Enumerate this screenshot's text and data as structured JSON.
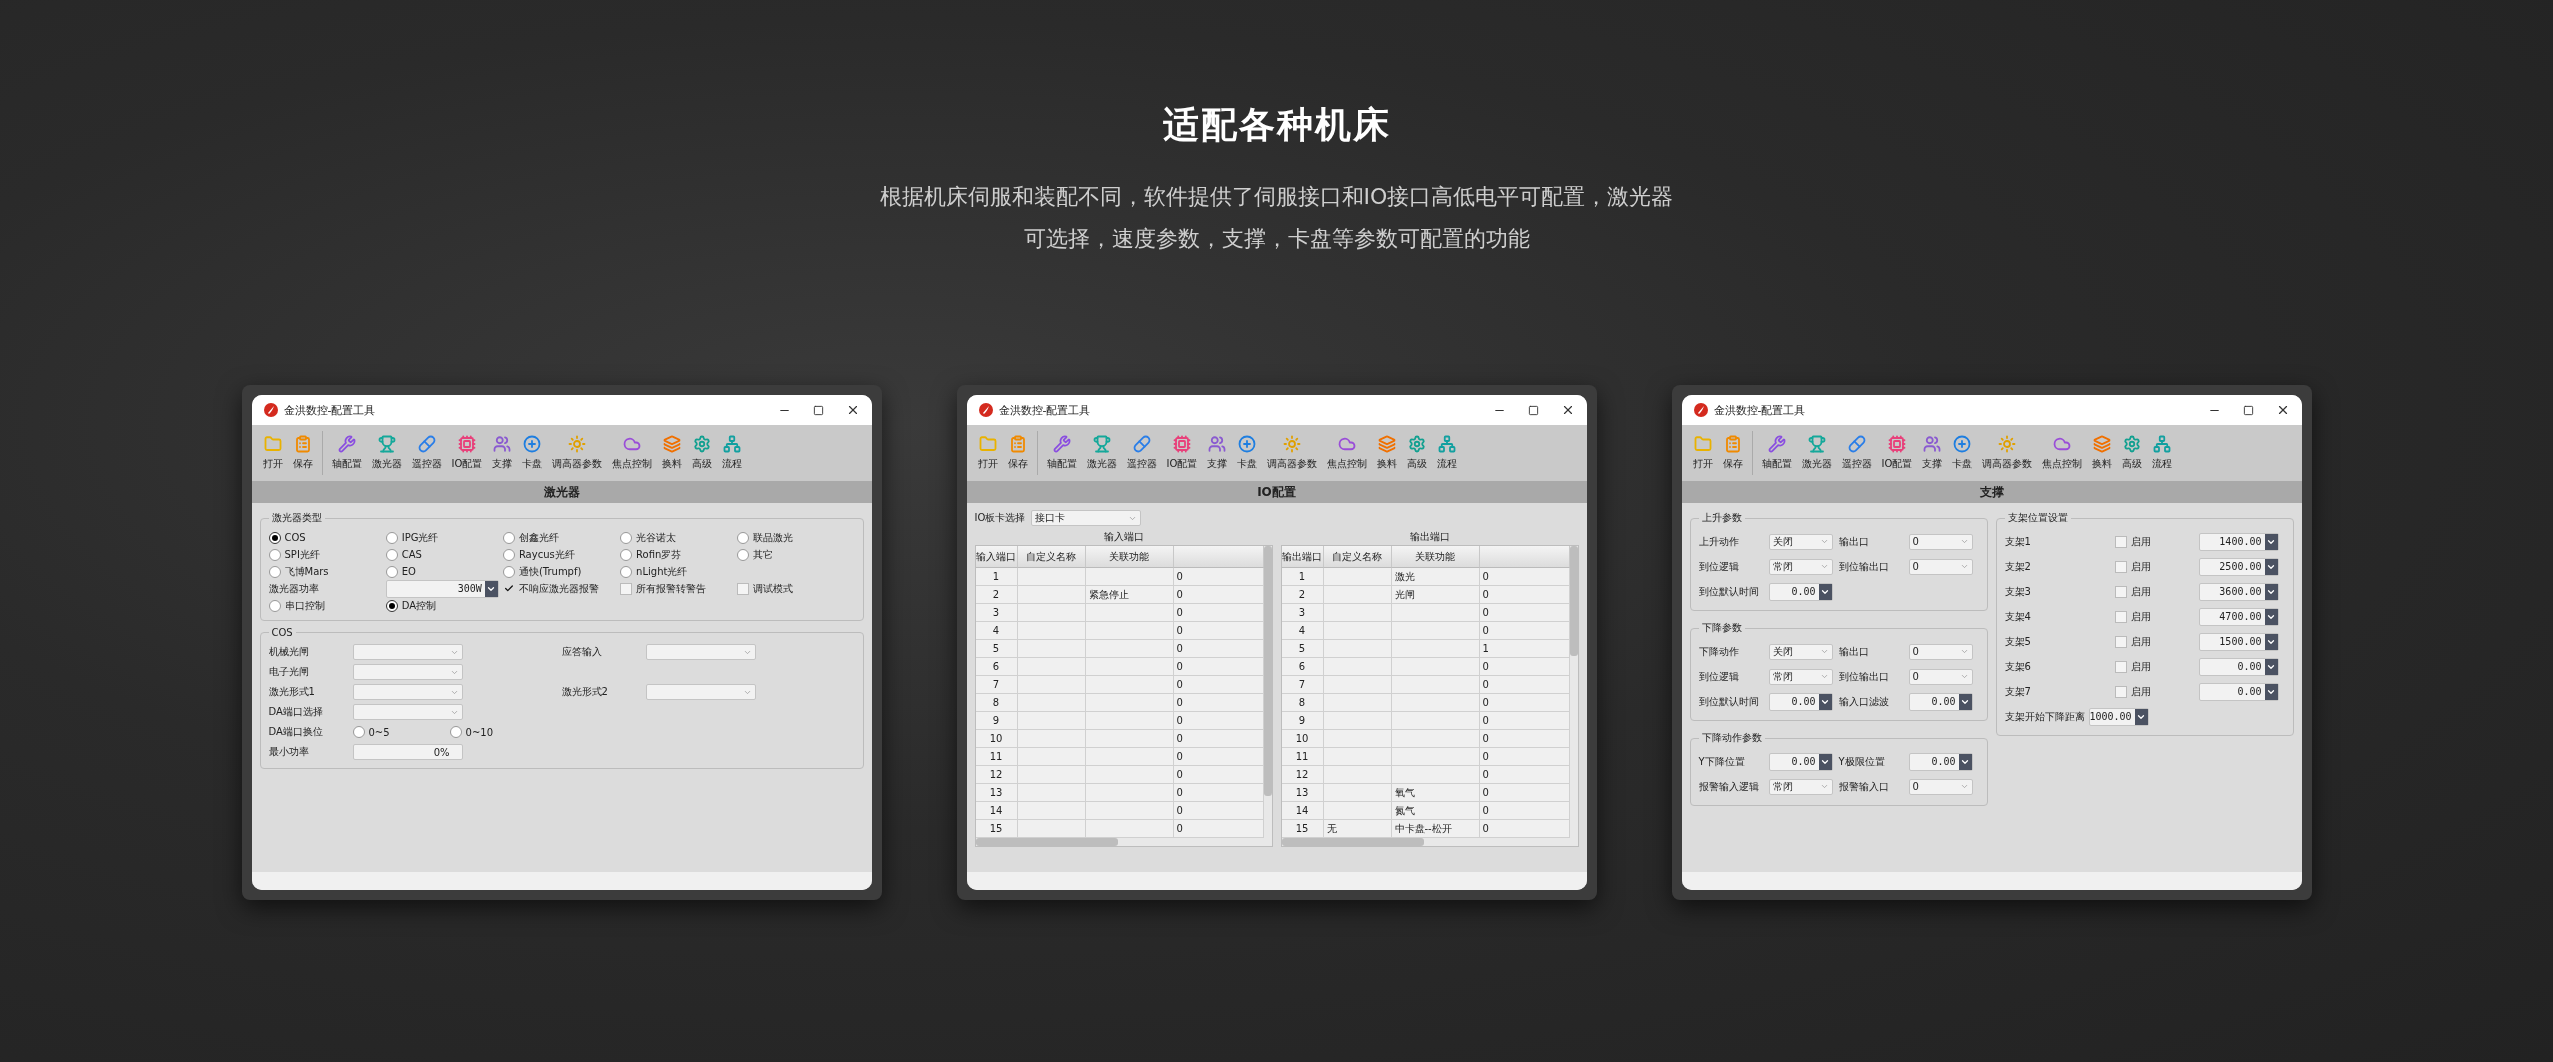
{
  "hero": {
    "title": "适配各种机床",
    "subtitle_lines": [
      "根据机床伺服和装配不同，软件提供了伺服接口和IO接口高低电平可配置，激光器",
      "可选择，速度参数，支撑，卡盘等参数可配置的功能"
    ]
  },
  "windows": [
    {
      "title": "金洪数控-配置工具",
      "toolbar": [
        {
          "items": [
            {
              "label": "打开"
            },
            {
              "label": "保存"
            }
          ]
        },
        {
          "items": [
            {
              "label": "轴配置"
            },
            {
              "label": "激光器"
            },
            {
              "label": "遥控器"
            },
            {
              "label": "IO配置"
            },
            {
              "label": "支撑"
            },
            {
              "label": "卡盘"
            },
            {
              "label": "调高器参数"
            },
            {
              "label": "焦点控制"
            },
            {
              "label": "换料"
            },
            {
              "label": "高级"
            },
            {
              "label": "流程"
            }
          ]
        }
      ],
      "section_title": "激光器",
      "panel": {
        "kind": "laser",
        "type_group": {
          "title": "激光器类型",
          "types": [
            {
              "label": "COS",
              "selected": true
            },
            {
              "label": "IPG光纤",
              "selected": false
            },
            {
              "label": "创鑫光纤",
              "selected": false
            },
            {
              "label": "光谷诺太",
              "selected": false
            },
            {
              "label": "联品激光",
              "selected": false
            },
            {
              "label": "SPI光纤",
              "selected": false
            },
            {
              "label": "CAS",
              "selected": false
            },
            {
              "label": "Raycus光纤",
              "selected": false
            },
            {
              "label": "Rofin罗芬",
              "selected": false
            },
            {
              "label": "其它",
              "selected": false
            },
            {
              "label": "飞博Mars",
              "selected": false
            },
            {
              "label": "EO",
              "selected": false
            },
            {
              "label": "通快(Trumpf)",
              "selected": false
            },
            {
              "label": "nLight光纤",
              "selected": false
            }
          ],
          "controls": [
            {
              "kind": "label",
              "text": "激光器功率"
            },
            {
              "kind": "spin",
              "value": "300W"
            },
            {
              "kind": "checkbox",
              "label": "不响应激光器报警",
              "checked": true
            },
            {
              "kind": "checkbox",
              "label": "所有报警转警告",
              "checked": false
            },
            {
              "kind": "checkbox",
              "label": "调试模式",
              "checked": false
            },
            {
              "kind": "radio",
              "label": "串口控制",
              "selected": false
            },
            {
              "kind": "radio",
              "label": "DA控制",
              "selected": true
            }
          ]
        },
        "groups": [
          {
            "title": "COS",
            "rows": [
              {
                "cells": [
                  {
                    "kind": "select",
                    "label": "机械光闸"
                  },
                  {
                    "kind": "select",
                    "label": "应答输入"
                  }
                ]
              },
              {
                "cells": [
                  {
                    "kind": "select",
                    "label": "电子光闸"
                  }
                ]
              },
              {
                "cells": [
                  {
                    "kind": "select",
                    "label": "激光形式1"
                  },
                  {
                    "kind": "select",
                    "label": "激光形式2"
                  }
                ]
              },
              {
                "cells": [
                  {
                    "kind": "select",
                    "label": "DA端口选择"
                  }
                ]
              },
              {
                "cells": [
                  {
                    "kind": "radios",
                    "label": "DA端口换位",
                    "options": [
                      {
                        "label": "0~5",
                        "selected": false
                      },
                      {
                        "label": "0~10",
                        "selected": false
                      }
                    ]
                  }
                ]
              },
              {
                "cells": [
                  {
                    "kind": "input",
                    "label": "最小功率",
                    "value": "0%"
                  }
                ]
              }
            ]
          }
        ]
      }
    },
    {
      "title": "金洪数控-配置工具",
      "toolbar": [
        {
          "items": [
            {
              "label": "打开"
            },
            {
              "label": "保存"
            }
          ]
        },
        {
          "items": [
            {
              "label": "轴配置"
            },
            {
              "label": "激光器"
            },
            {
              "label": "遥控器"
            },
            {
              "label": "IO配置"
            },
            {
              "label": "支撑"
            },
            {
              "label": "卡盘"
            },
            {
              "label": "调高器参数"
            },
            {
              "label": "焦点控制"
            },
            {
              "label": "换料"
            },
            {
              "label": "高级"
            },
            {
              "label": "流程"
            }
          ]
        }
      ],
      "section_title": "IO配置",
      "panel": {
        "kind": "io",
        "board": {
          "label": "IO板卡选择",
          "value": "接口卡"
        },
        "tables": [
          {
            "title": "输入端口",
            "columns": [
              "输入端口",
              "自定义名称",
              "关联功能"
            ],
            "rows": [
              {
                "port": "1",
                "column_4": "0"
              },
              {
                "port": "2",
                "function": "紧急停止",
                "column_4": "0"
              },
              {
                "port": "3",
                "column_4": "0"
              },
              {
                "port": "4",
                "column_4": "0"
              },
              {
                "port": "5",
                "column_4": "0"
              },
              {
                "port": "6",
                "column_4": "0"
              },
              {
                "port": "7",
                "column_4": "0"
              },
              {
                "port": "8",
                "column_4": "0"
              },
              {
                "port": "9",
                "column_4": "0"
              },
              {
                "port": "10",
                "column_4": "0"
              },
              {
                "port": "11",
                "column_4": "0"
              },
              {
                "port": "12",
                "column_4": "0"
              },
              {
                "port": "13",
                "column_4": "0"
              },
              {
                "port": "14",
                "column_4": "0"
              },
              {
                "port": "15",
                "column_4": "0"
              }
            ]
          },
          {
            "title": "输出端口",
            "columns": [
              "输出端口",
              "自定义名称",
              "关联功能"
            ],
            "rows": [
              {
                "port": "1",
                "function": "激光",
                "column_4": "0"
              },
              {
                "port": "2",
                "function": "光闸",
                "column_4": "0"
              },
              {
                "port": "3",
                "column_4": "0"
              },
              {
                "port": "4",
                "column_4": "0"
              },
              {
                "port": "5",
                "column_4": "1"
              },
              {
                "port": "6",
                "column_4": "0"
              },
              {
                "port": "7",
                "column_4": "0"
              },
              {
                "port": "8",
                "column_4": "0"
              },
              {
                "port": "9",
                "column_4": "0"
              },
              {
                "port": "10",
                "column_4": "0"
              },
              {
                "port": "11",
                "column_4": "0"
              },
              {
                "port": "12",
                "column_4": "0"
              },
              {
                "port": "13",
                "function": "氧气",
                "column_4": "0"
              },
              {
                "port": "14",
                "function": "氮气",
                "column_4": "0"
              },
              {
                "port": "15",
                "name": "无",
                "function": "中卡盘--松开",
                "column_4": "0"
              }
            ]
          }
        ]
      }
    },
    {
      "title": "金洪数控-配置工具",
      "toolbar": [
        {
          "items": [
            {
              "label": "打开"
            },
            {
              "label": "保存"
            }
          ]
        },
        {
          "items": [
            {
              "label": "轴配置"
            },
            {
              "label": "激光器"
            },
            {
              "label": "遥控器"
            },
            {
              "label": "IO配置"
            },
            {
              "label": "支撑"
            },
            {
              "label": "卡盘"
            },
            {
              "label": "调高器参数"
            },
            {
              "label": "焦点控制"
            },
            {
              "label": "换料"
            },
            {
              "label": "高级"
            },
            {
              "label": "流程"
            }
          ]
        }
      ],
      "section_title": "支撑",
      "panel": {
        "kind": "support",
        "columns": [
          {
            "groups": [
              {
                "title": "上升参数",
                "rows": [
                  {
                    "cells": [
                      {
                        "kind": "select",
                        "label": "上升动作",
                        "value": "关闭"
                      },
                      {
                        "kind": "select",
                        "label": "输出口",
                        "value": "0"
                      }
                    ]
                  },
                  {
                    "cells": [
                      {
                        "kind": "select",
                        "label": "到位逻辑",
                        "value": "常闭"
                      },
                      {
                        "kind": "select",
                        "label": "到位输出口",
                        "value": "0"
                      }
                    ]
                  },
                  {
                    "cells": [
                      {
                        "kind": "spin",
                        "label": "到位默认时间",
                        "value": "0.00"
                      }
                    ]
                  }
                ]
              },
              {
                "title": "下降参数",
                "rows": [
                  {
                    "cells": [
                      {
                        "kind": "select",
                        "label": "下降动作",
                        "value": "关闭"
                      },
                      {
                        "kind": "select",
                        "label": "输出口",
                        "value": "0"
                      }
                    ]
                  },
                  {
                    "cells": [
                      {
                        "kind": "select",
                        "label": "到位逻辑",
                        "value": "常闭"
                      },
                      {
                        "kind": "select",
                        "label": "到位输出口",
                        "value": "0"
                      }
                    ]
                  },
                  {
                    "cells": [
                      {
                        "kind": "spin",
                        "label": "到位默认时间",
                        "value": "0.00"
                      },
                      {
                        "kind": "spin",
                        "label": "输入口滤波",
                        "value": "0.00"
                      }
                    ]
                  }
                ]
              },
              {
                "title": "下降动作参数",
                "rows": [
                  {
                    "cells": [
                      {
                        "kind": "spin",
                        "label": "Y下降位置",
                        "value": "0.00"
                      },
                      {
                        "kind": "spin",
                        "label": "Y极限位置",
                        "value": "0.00"
                      }
                    ]
                  },
                  {
                    "cells": [
                      {
                        "kind": "select",
                        "label": "报警输入逻辑",
                        "value": "常闭"
                      },
                      {
                        "kind": "select",
                        "label": "报警输入口",
                        "value": "0"
                      }
                    ]
                  }
                ]
              }
            ]
          },
          {
            "groups": [
              {
                "title": "支架位置设置",
                "rows": [
                  {
                    "cells": [
                      {
                        "kind": "bracket",
                        "label": "支架1",
                        "check_label": "启用",
                        "checked": false,
                        "value": "1400.00"
                      }
                    ]
                  },
                  {
                    "cells": [
                      {
                        "kind": "bracket",
                        "label": "支架2",
                        "check_label": "启用",
                        "checked": false,
                        "value": "2500.00"
                      }
                    ]
                  },
                  {
                    "cells": [
                      {
                        "kind": "bracket",
                        "label": "支架3",
                        "check_label": "启用",
                        "checked": false,
                        "value": "3600.00"
                      }
                    ]
                  },
                  {
                    "cells": [
                      {
                        "kind": "bracket",
                        "label": "支架4",
                        "check_label": "启用",
                        "checked": false,
                        "value": "4700.00"
                      }
                    ]
                  },
                  {
                    "cells": [
                      {
                        "kind": "bracket",
                        "label": "支架5",
                        "check_label": "启用",
                        "checked": false,
                        "value": "1500.00"
                      }
                    ]
                  },
                  {
                    "cells": [
                      {
                        "kind": "bracket",
                        "label": "支架6",
                        "check_label": "启用",
                        "checked": false,
                        "value": "0.00"
                      }
                    ]
                  },
                  {
                    "cells": [
                      {
                        "kind": "bracket",
                        "label": "支架7",
                        "check_label": "启用",
                        "checked": false,
                        "value": "0.00"
                      }
                    ]
                  },
                  {
                    "cells": [
                      {
                        "kind": "spin",
                        "label": "支架开始下降距离",
                        "value": "1000.00"
                      }
                    ]
                  }
                ]
              }
            ]
          }
        ]
      }
    }
  ]
}
